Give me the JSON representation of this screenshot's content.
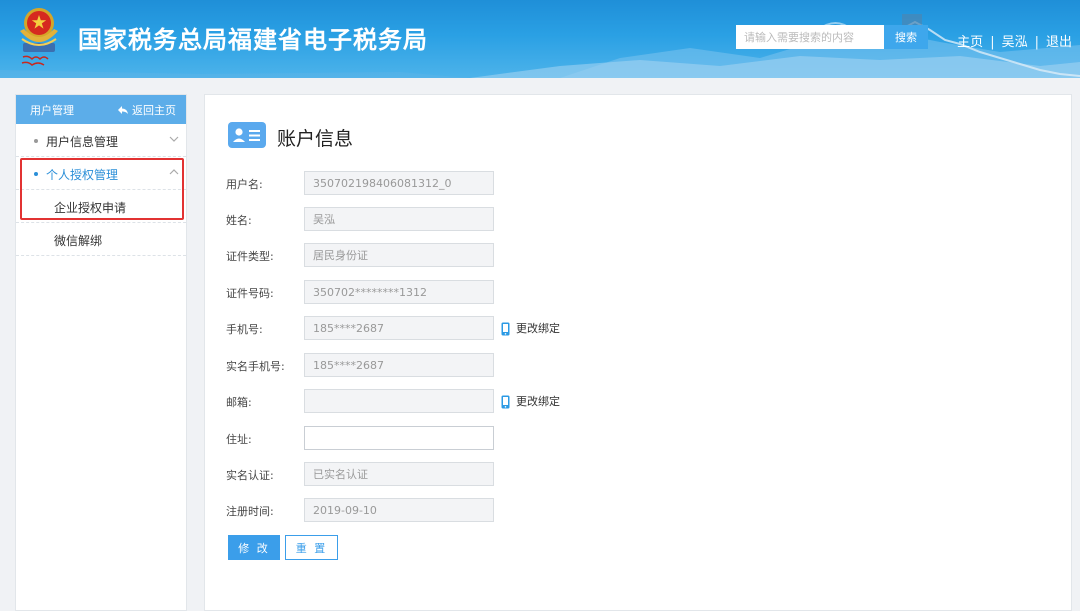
{
  "header": {
    "title": "国家税务总局福建省电子税务局",
    "search": {
      "placeholder": "请输入需要搜索的内容",
      "button_label": "搜索"
    },
    "nav": {
      "home": "主页",
      "sep1": "|",
      "user": "吴泓",
      "sep2": "|",
      "logout": "退出"
    },
    "colors": {
      "background": "#2aa0e4",
      "search_button": "#3ea7ec"
    }
  },
  "sidebar": {
    "title": "用户管理",
    "back_label": "返回主页",
    "items": [
      {
        "label": "用户信息管理",
        "expanded": false
      },
      {
        "label": "个人授权管理",
        "expanded": true,
        "active": true
      }
    ],
    "sub_items": [
      {
        "label": "企业授权申请"
      },
      {
        "label": "微信解绑"
      }
    ],
    "colors": {
      "header": "#5cade9",
      "active": "#2b8fd8",
      "highlight": "#e23232"
    }
  },
  "main": {
    "title": "账户信息",
    "fields": [
      {
        "label": "用户名:",
        "value": "350702198406081312_0"
      },
      {
        "label": "姓名:",
        "value": "吴泓"
      },
      {
        "label": "证件类型:",
        "value": "居民身份证"
      },
      {
        "label": "证件号码:",
        "value": "350702********1312"
      },
      {
        "label": "手机号:",
        "value": "185****2687",
        "action": "更改绑定"
      },
      {
        "label": "实名手机号:",
        "value": "185****2687"
      },
      {
        "label": "邮箱:",
        "value": "",
        "action": "更改绑定"
      },
      {
        "label": "住址:",
        "value": ""
      },
      {
        "label": "实名认证:",
        "value": "已实名认证"
      },
      {
        "label": "注册时间:",
        "value": "2019-09-10"
      }
    ],
    "buttons": {
      "modify": "修 改",
      "reset": "重 置"
    },
    "colors": {
      "primary": "#3b9eea"
    }
  }
}
